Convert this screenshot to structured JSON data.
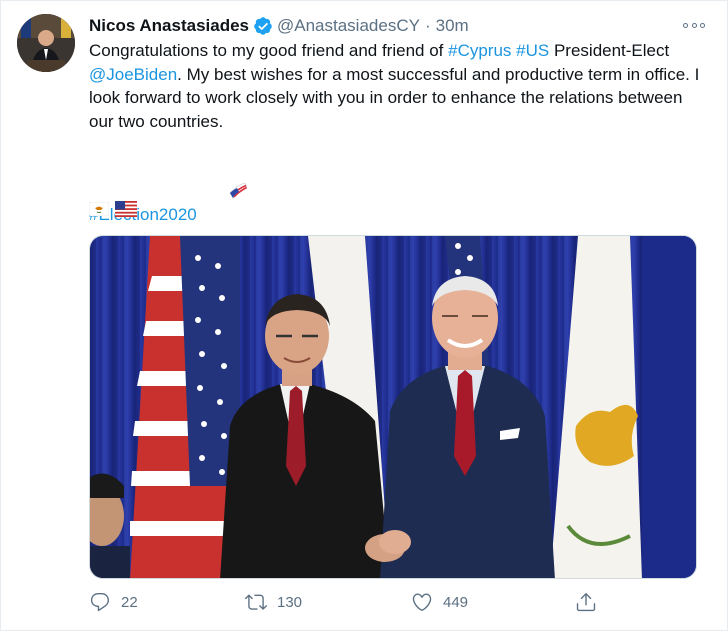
{
  "author": {
    "name": "Nicos Anastasiades",
    "handle": "@AnastasiadesCY",
    "separator": "·",
    "time": "30m",
    "verified": true
  },
  "tweet": {
    "text_before_cyprus": "Congratulations to my good friend and friend of ",
    "hashtag_cyprus": "#Cyprus",
    "hashtag_us": "#US",
    "text_after_us": " President-Elect ",
    "mention_biden": "@JoeBiden",
    "text_after_mention": ". My best wishes for a most successful and productive term in office. I look forward to work closely with you in order to enhance the relations between our two countries.",
    "hashtag_election": "#Election2020",
    "flag_emojis": [
      "cyprus-flag",
      "us-flag"
    ]
  },
  "media": {
    "type": "photo"
  },
  "actions": {
    "reply_count": "22",
    "retweet_count": "130",
    "like_count": "449"
  },
  "colors": {
    "link": "#1b95e0",
    "secondary_text": "#5b7083",
    "verified_badge": "#1da1f2",
    "curtain_blue": "#1c2e8c"
  }
}
